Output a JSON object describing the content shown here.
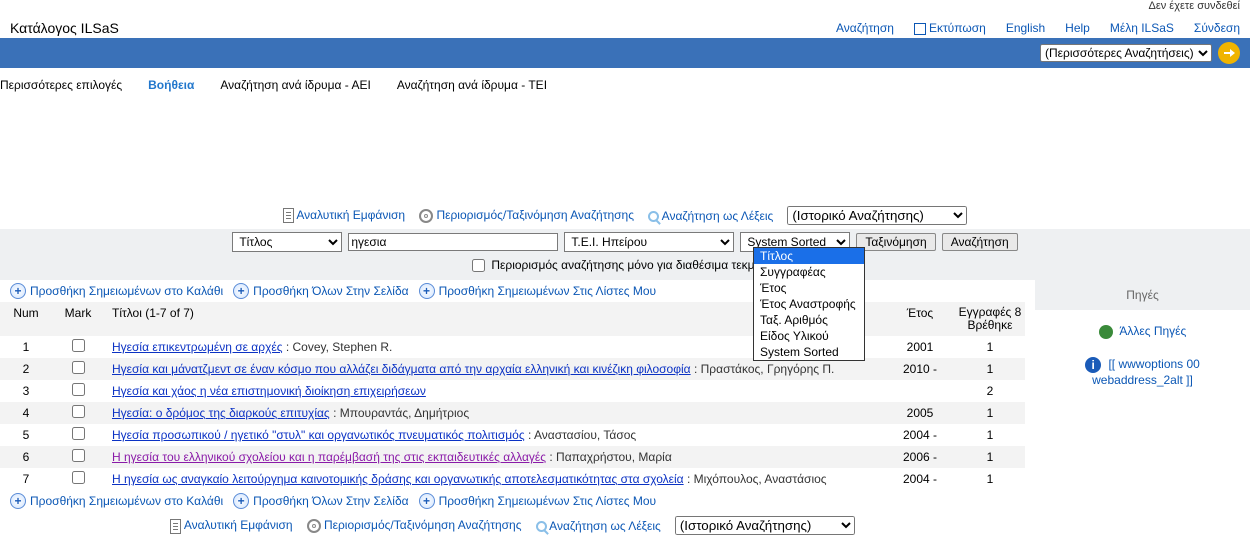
{
  "topbar": {
    "not_logged_in": "Δεν έχετε συνδεθεί"
  },
  "logo": "Κατάλογος ILSaS",
  "topnav": {
    "search": "Αναζήτηση",
    "print": "Εκτύπωση",
    "english": "English",
    "help": "Help",
    "members": "Μέλη ILSaS",
    "login": "Σύνδεση"
  },
  "bluebar": {
    "more_searches": "(Περισσότερες Αναζητήσεις)"
  },
  "subnav": {
    "more_options": "Περισσότερες επιλογές",
    "help": "Βοήθεια",
    "search_aei": "Αναζήτηση ανά ίδρυμα - ΑΕΙ",
    "search_tei": "Αναζήτηση ανά ίδρυμα - ΤΕΙ"
  },
  "actions": {
    "detailed_view": "Αναλυτική Εμφάνιση",
    "limit_sort": "Περιορισμός/Ταξινόμηση Αναζήτησης",
    "search_words": "Αναζήτηση ως Λέξεις",
    "history": "(Ιστορικό Αναζήτησης)"
  },
  "search": {
    "field_select": "Τίτλος",
    "query": "ηγεσια",
    "scope": "Τ.Ε.Ι. Ηπείρου",
    "sort": "System Sorted",
    "sort_btn": "Ταξινόμηση",
    "search_btn": "Αναζήτηση",
    "limit_checkbox_label": "Περιορισμός αναζήτησης μόνο για διαθέσιμα τεκμήρια"
  },
  "sort_options": [
    "Τίτλος",
    "Συγγραφέας",
    "Έτος",
    "Έτος Αναστροφής",
    "Ταξ. Αριθμός",
    "Είδος Υλικού",
    "System Sorted"
  ],
  "cart": {
    "add_marked": "Προσθήκη Σημειωμένων στο Καλάθι",
    "add_all_page": "Προσθήκη Όλων Στην Σελίδα",
    "add_marked_lists": "Προσθήκη Σημειωμένων Στις Λίστες Μου"
  },
  "headers": {
    "num": "Num",
    "mark": "Mark",
    "titles": "Τίτλοι (1-7 of 7)",
    "year": "Έτος",
    "records_found": "Εγγραφές 8 Βρέθηκε"
  },
  "rows": [
    {
      "num": "1",
      "title": "Ηγεσία επικεντρωμένη σε αρχές",
      "author": "Covey, Stephen R.",
      "year": "2001",
      "records": "1",
      "visited": false
    },
    {
      "num": "2",
      "title": "Ηγεσία και μάνατζμεντ σε έναν κόσμο που αλλάζει διδάγματα από την αρχαία ελληνική και κινέζικη φιλοσοφία",
      "author": "Πραστάκος, Γρηγόρης Π.",
      "year": "2010 -",
      "records": "1",
      "visited": false
    },
    {
      "num": "3",
      "title": "Ηγεσία και χάος η νέα επιστημονική διοίκηση επιχειρήσεων",
      "author": "",
      "year": "",
      "records": "2",
      "visited": false
    },
    {
      "num": "4",
      "title": "Ηγεσία: ο δρόμος της διαρκούς επιτυχίας",
      "author": "Μπουραντάς, Δημήτριος",
      "year": "2005",
      "records": "1",
      "visited": false
    },
    {
      "num": "5",
      "title": "Ηγεσία προσωπικού / ηγετικό \"στυλ\" και οργανωτικός πνευματικός πολιτισμός",
      "author": "Αναστασίου, Τάσος",
      "year": "2004 -",
      "records": "1",
      "visited": false
    },
    {
      "num": "6",
      "title": "Η ηγεσία του ελληνικού σχολείου και η παρέμβασή της στις εκπαιδευτικές αλλαγές",
      "author": "Παπαχρήστου, Μαρία",
      "year": "2006 -",
      "records": "1",
      "visited": true
    },
    {
      "num": "7",
      "title": "Η ηγεσία ως αναγκαίο λειτούργημα καινοτομικής δράσης και οργανωτικής αποτελεσματικότητας στα σχολεία",
      "author": "Μιχόπουλος, Αναστάσιος",
      "year": "2004 -",
      "records": "1",
      "visited": false
    }
  ],
  "side": {
    "sources_title": "Πηγές",
    "other_sources": "Άλλες Πηγές",
    "wwwoptions": "[[ wwwoptions 00 webaddress_2alt ]]"
  }
}
